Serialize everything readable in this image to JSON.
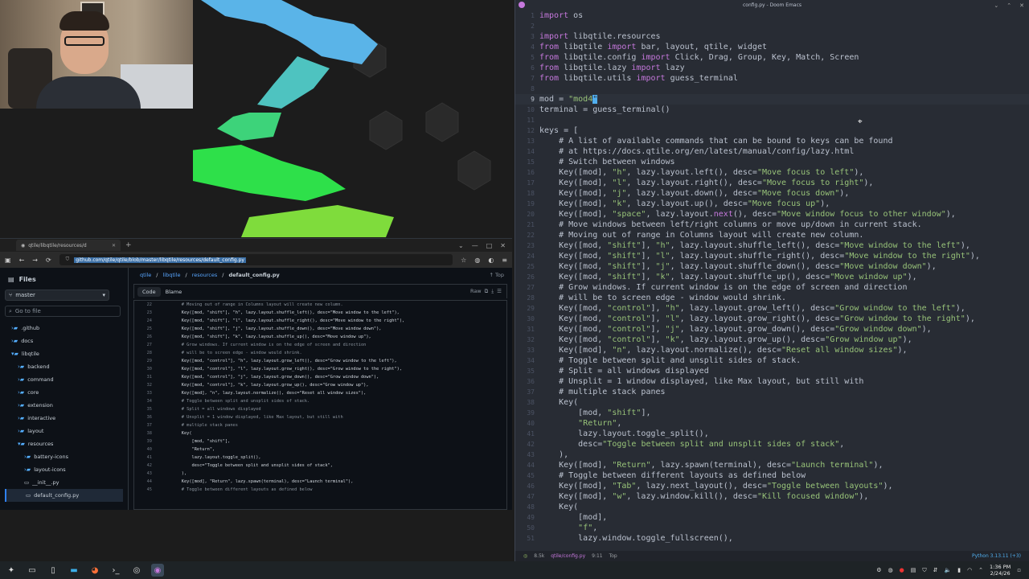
{
  "browser": {
    "tab_title": "qtile/libqtile/resources/d",
    "url": "github.com/qtile/qtile/blob/master/libqtile/resources/default_config.py",
    "files_title": "Files",
    "branch": "master",
    "goto_placeholder": "Go to file",
    "tree": [
      {
        "label": ".github",
        "type": "folder",
        "depth": 1
      },
      {
        "label": "docs",
        "type": "folder",
        "depth": 1
      },
      {
        "label": "libqtile",
        "type": "folder-open",
        "depth": 1
      },
      {
        "label": "backend",
        "type": "folder",
        "depth": 2
      },
      {
        "label": "command",
        "type": "folder",
        "depth": 2
      },
      {
        "label": "core",
        "type": "folder",
        "depth": 2
      },
      {
        "label": "extension",
        "type": "folder",
        "depth": 2
      },
      {
        "label": "interactive",
        "type": "folder",
        "depth": 2
      },
      {
        "label": "layout",
        "type": "folder",
        "depth": 2
      },
      {
        "label": "resources",
        "type": "folder-open",
        "depth": 2
      },
      {
        "label": "battery-icons",
        "type": "folder",
        "depth": 3
      },
      {
        "label": "layout-icons",
        "type": "folder",
        "depth": 3
      },
      {
        "label": "__init__.py",
        "type": "file",
        "depth": 3
      },
      {
        "label": "default_config.py",
        "type": "file",
        "depth": 3,
        "selected": true
      }
    ],
    "breadcrumb": [
      "qtile",
      "libqtile",
      "resources"
    ],
    "breadcrumb_file": "default_config.py",
    "top_label": "Top",
    "code_tab": "Code",
    "blame_tab": "Blame",
    "raw_label": "Raw",
    "code_lines": [
      {
        "n": "22",
        "t": "    # Moving out of range in Columns layout will create new column.",
        "c": true
      },
      {
        "n": "23",
        "t": "    Key([mod, \"shift\"], \"h\", lazy.layout.shuffle_left(), desc=\"Move window to the left\"),"
      },
      {
        "n": "24",
        "t": "    Key([mod, \"shift\"], \"l\", lazy.layout.shuffle_right(), desc=\"Move window to the right\"),"
      },
      {
        "n": "25",
        "t": "    Key([mod, \"shift\"], \"j\", lazy.layout.shuffle_down(), desc=\"Move window down\"),"
      },
      {
        "n": "26",
        "t": "    Key([mod, \"shift\"], \"k\", lazy.layout.shuffle_up(), desc=\"Move window up\"),"
      },
      {
        "n": "27",
        "t": "    # Grow windows. If current window is on the edge of screen and direction",
        "c": true
      },
      {
        "n": "28",
        "t": "    # will be to screen edge - window would shrink.",
        "c": true
      },
      {
        "n": "29",
        "t": "    Key([mod, \"control\"], \"h\", lazy.layout.grow_left(), desc=\"Grow window to the left\"),"
      },
      {
        "n": "30",
        "t": "    Key([mod, \"control\"], \"l\", lazy.layout.grow_right(), desc=\"Grow window to the right\"),"
      },
      {
        "n": "31",
        "t": "    Key([mod, \"control\"], \"j\", lazy.layout.grow_down(), desc=\"Grow window down\"),"
      },
      {
        "n": "32",
        "t": "    Key([mod, \"control\"], \"k\", lazy.layout.grow_up(), desc=\"Grow window up\"),"
      },
      {
        "n": "33",
        "t": "    Key([mod], \"n\", lazy.layout.normalize(), desc=\"Reset all window sizes\"),"
      },
      {
        "n": "34",
        "t": "    # Toggle between split and unsplit sides of stack.",
        "c": true
      },
      {
        "n": "35",
        "t": "    # Split = all windows displayed",
        "c": true
      },
      {
        "n": "36",
        "t": "    # Unsplit = 1 window displayed, like Max layout, but still with",
        "c": true
      },
      {
        "n": "37",
        "t": "    # multiple stack panes",
        "c": true
      },
      {
        "n": "38",
        "t": "    Key("
      },
      {
        "n": "39",
        "t": "        [mod, \"shift\"],"
      },
      {
        "n": "40",
        "t": "        \"Return\","
      },
      {
        "n": "41",
        "t": "        lazy.layout.toggle_split(),"
      },
      {
        "n": "42",
        "t": "        desc=\"Toggle between split and unsplit sides of stack\","
      },
      {
        "n": "43",
        "t": "    ),"
      },
      {
        "n": "44",
        "t": "    Key([mod], \"Return\", lazy.spawn(terminal), desc=\"Launch terminal\"),"
      },
      {
        "n": "45",
        "t": "    # Toggle between different layouts as defined below",
        "c": true
      }
    ]
  },
  "editor": {
    "title": "config.py - Doom Emacs",
    "modeline_pos": "8.5k",
    "modeline_file": "qtile/config.py",
    "modeline_col": "9:11",
    "modeline_top": "Top",
    "language": "Python 3.13.11 (+3)",
    "current_line": "9"
  },
  "taskbar": {
    "time": "1:36 PM",
    "date": "2/24/26"
  }
}
